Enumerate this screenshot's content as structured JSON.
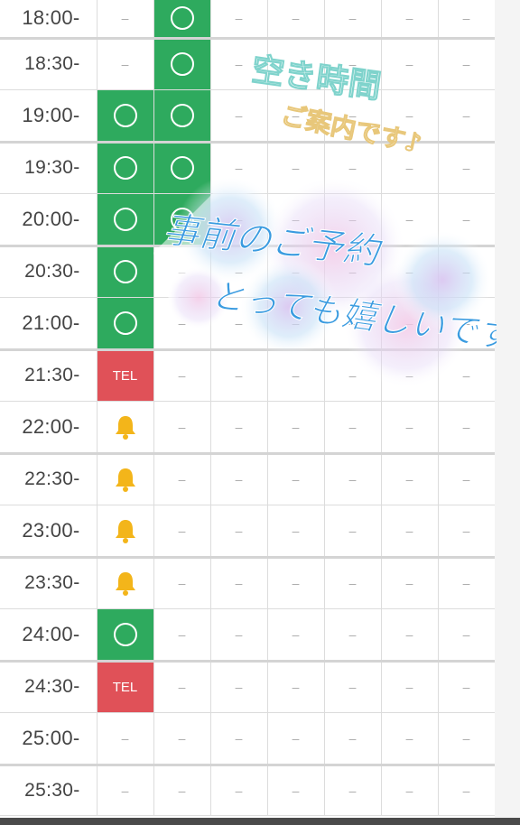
{
  "schedule": {
    "rows": [
      {
        "time": "18:00-",
        "cells": [
          "dash",
          "ok",
          "dash",
          "dash",
          "dash",
          "dash",
          "dash"
        ]
      },
      {
        "time": "18:30-",
        "cells": [
          "dash",
          "ok",
          "dash",
          "dash",
          "dash",
          "dash",
          "dash"
        ]
      },
      {
        "time": "19:00-",
        "cells": [
          "ok",
          "ok",
          "dash",
          "dash",
          "dash",
          "dash",
          "dash"
        ]
      },
      {
        "time": "19:30-",
        "cells": [
          "ok",
          "ok",
          "dash",
          "dash",
          "dash",
          "dash",
          "dash"
        ]
      },
      {
        "time": "20:00-",
        "cells": [
          "ok",
          "ok",
          "dash",
          "dash",
          "dash",
          "dash",
          "dash"
        ]
      },
      {
        "time": "20:30-",
        "cells": [
          "ok",
          "dash",
          "dash",
          "dash",
          "dash",
          "dash",
          "dash"
        ]
      },
      {
        "time": "21:00-",
        "cells": [
          "ok",
          "dash",
          "dash",
          "dash",
          "dash",
          "dash",
          "dash"
        ]
      },
      {
        "time": "21:30-",
        "cells": [
          "tel",
          "dash",
          "dash",
          "dash",
          "dash",
          "dash",
          "dash"
        ]
      },
      {
        "time": "22:00-",
        "cells": [
          "bell",
          "dash",
          "dash",
          "dash",
          "dash",
          "dash",
          "dash"
        ]
      },
      {
        "time": "22:30-",
        "cells": [
          "bell",
          "dash",
          "dash",
          "dash",
          "dash",
          "dash",
          "dash"
        ]
      },
      {
        "time": "23:00-",
        "cells": [
          "bell",
          "dash",
          "dash",
          "dash",
          "dash",
          "dash",
          "dash"
        ]
      },
      {
        "time": "23:30-",
        "cells": [
          "bell",
          "dash",
          "dash",
          "dash",
          "dash",
          "dash",
          "dash"
        ]
      },
      {
        "time": "24:00-",
        "cells": [
          "ok",
          "dash",
          "dash",
          "dash",
          "dash",
          "dash",
          "dash"
        ]
      },
      {
        "time": "24:30-",
        "cells": [
          "tel",
          "dash",
          "dash",
          "dash",
          "dash",
          "dash",
          "dash"
        ]
      },
      {
        "time": "25:00-",
        "cells": [
          "dash",
          "dash",
          "dash",
          "dash",
          "dash",
          "dash",
          "dash"
        ]
      },
      {
        "time": "25:30-",
        "cells": [
          "dash",
          "dash",
          "dash",
          "dash",
          "dash",
          "dash",
          "dash"
        ]
      }
    ]
  },
  "labels": {
    "dash": "–",
    "tel": "TEL"
  },
  "overlay": {
    "line1": "空き時間",
    "line2": "ご案内です♪",
    "line3": "事前のご予約",
    "line4": "とっても嬉しいです"
  },
  "colors": {
    "available": "#2eaa5e",
    "tel": "#e05158",
    "bell": "#f3b51a",
    "overlay_teal": "#7fd3cc",
    "overlay_gold": "#e8c77a",
    "overlay_blue": "#3a9be0"
  },
  "icons": {
    "available": "circle-icon",
    "reservation_pending": "bell-icon"
  }
}
